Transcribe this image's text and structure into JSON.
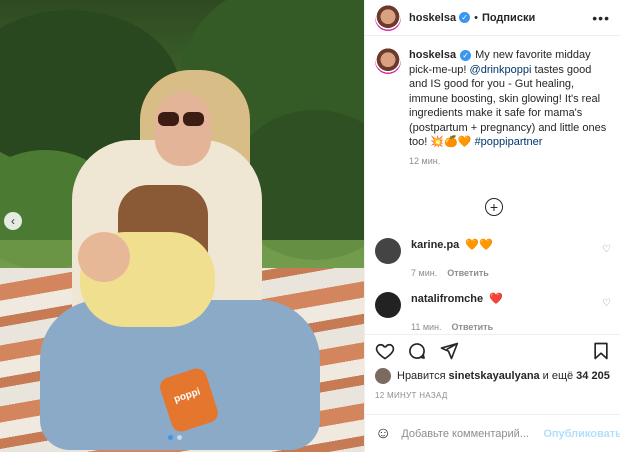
{
  "header": {
    "username": "hoskelsa",
    "separator": "•",
    "follow_label": "Подписки",
    "more_label": "•••"
  },
  "caption": {
    "username": "hoskelsa",
    "text_1": "My new favorite midday pick-me-up! ",
    "mention": "@drinkpoppi",
    "text_2": " tastes good and IS good for you - Gut healing, immune boosting, skin glowing! It's real ingredients make it safe for mama's (postpartum + pregnancy) and little ones too! 💥🍊🧡 ",
    "hashtag": "#poppipartner",
    "time": "12 мин."
  },
  "comments": [
    {
      "username": "karine.pa",
      "text": "🧡🧡",
      "time": "7 мин.",
      "reply": "Ответить"
    },
    {
      "username": "natalifromche",
      "text": "❤️",
      "time": "11 мин.",
      "reply": "Ответить"
    }
  ],
  "likes": {
    "prefix": "Нравится",
    "user": "sinetskayaulyana",
    "and_more": "и ещё",
    "count": "34 205"
  },
  "posted": "12 МИНУТ НАЗАД",
  "add_comment": {
    "placeholder": "Добавьте комментарий...",
    "publish_label": "Опубликовать"
  },
  "photo": {
    "can_label": "poppi",
    "carousel_dots": 2,
    "active_dot": 0
  },
  "colors": {
    "accent": "#3897f0",
    "link": "#00376b",
    "publish_disabled": "#b2dffc"
  }
}
